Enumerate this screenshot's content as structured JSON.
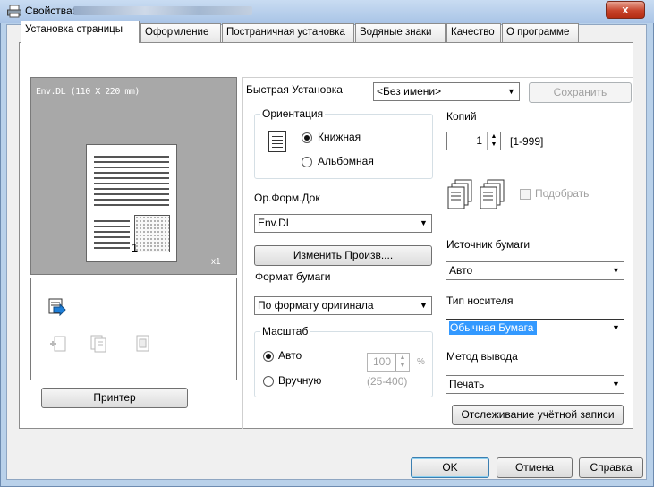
{
  "window": {
    "title": "Свойства:",
    "close_label": "x"
  },
  "tabs": [
    {
      "label": "Установка страницы",
      "active": true
    },
    {
      "label": "Оформление",
      "active": false
    },
    {
      "label": "Постраничная установка",
      "active": false
    },
    {
      "label": "Водяные знаки",
      "active": false
    },
    {
      "label": "Качество",
      "active": false
    },
    {
      "label": "О программе",
      "active": false
    }
  ],
  "preview": {
    "paper_label": "Env.DL  (110 X 220 mm)",
    "page_number": "1",
    "copies_badge": "x1",
    "printer_button": "Принтер"
  },
  "quick_setup": {
    "label": "Быстрая Установка",
    "value": "<Без имени>",
    "save_button": "Сохранить"
  },
  "orientation": {
    "label": "Ориентация",
    "portrait": "Книжная",
    "landscape": "Альбомная",
    "selected": "portrait"
  },
  "copies": {
    "label": "Копий",
    "value": "1",
    "range": "[1-999]",
    "collate_label": "Подобрать"
  },
  "original_size": {
    "label": "Ор.Форм.Док",
    "value": "Env.DL",
    "custom_button": "Изменить Произв...."
  },
  "paper_size": {
    "label": "Формат бумаги",
    "value": "По формату оригинала"
  },
  "paper_source": {
    "label": "Источник бумаги",
    "value": "Авто"
  },
  "paper_type": {
    "label": "Тип носителя",
    "value": "Обычная Бумага"
  },
  "zoom": {
    "label": "Масштаб",
    "auto": "Авто",
    "manual": "Вручную",
    "value": "100",
    "unit": "%",
    "range": "(25-400)",
    "selected": "auto"
  },
  "output_method": {
    "label": "Метод вывода",
    "value": "Печать"
  },
  "account_button": "Отслеживание учётной записи",
  "footer": {
    "ok": "OK",
    "cancel": "Отмена",
    "help": "Справка"
  }
}
